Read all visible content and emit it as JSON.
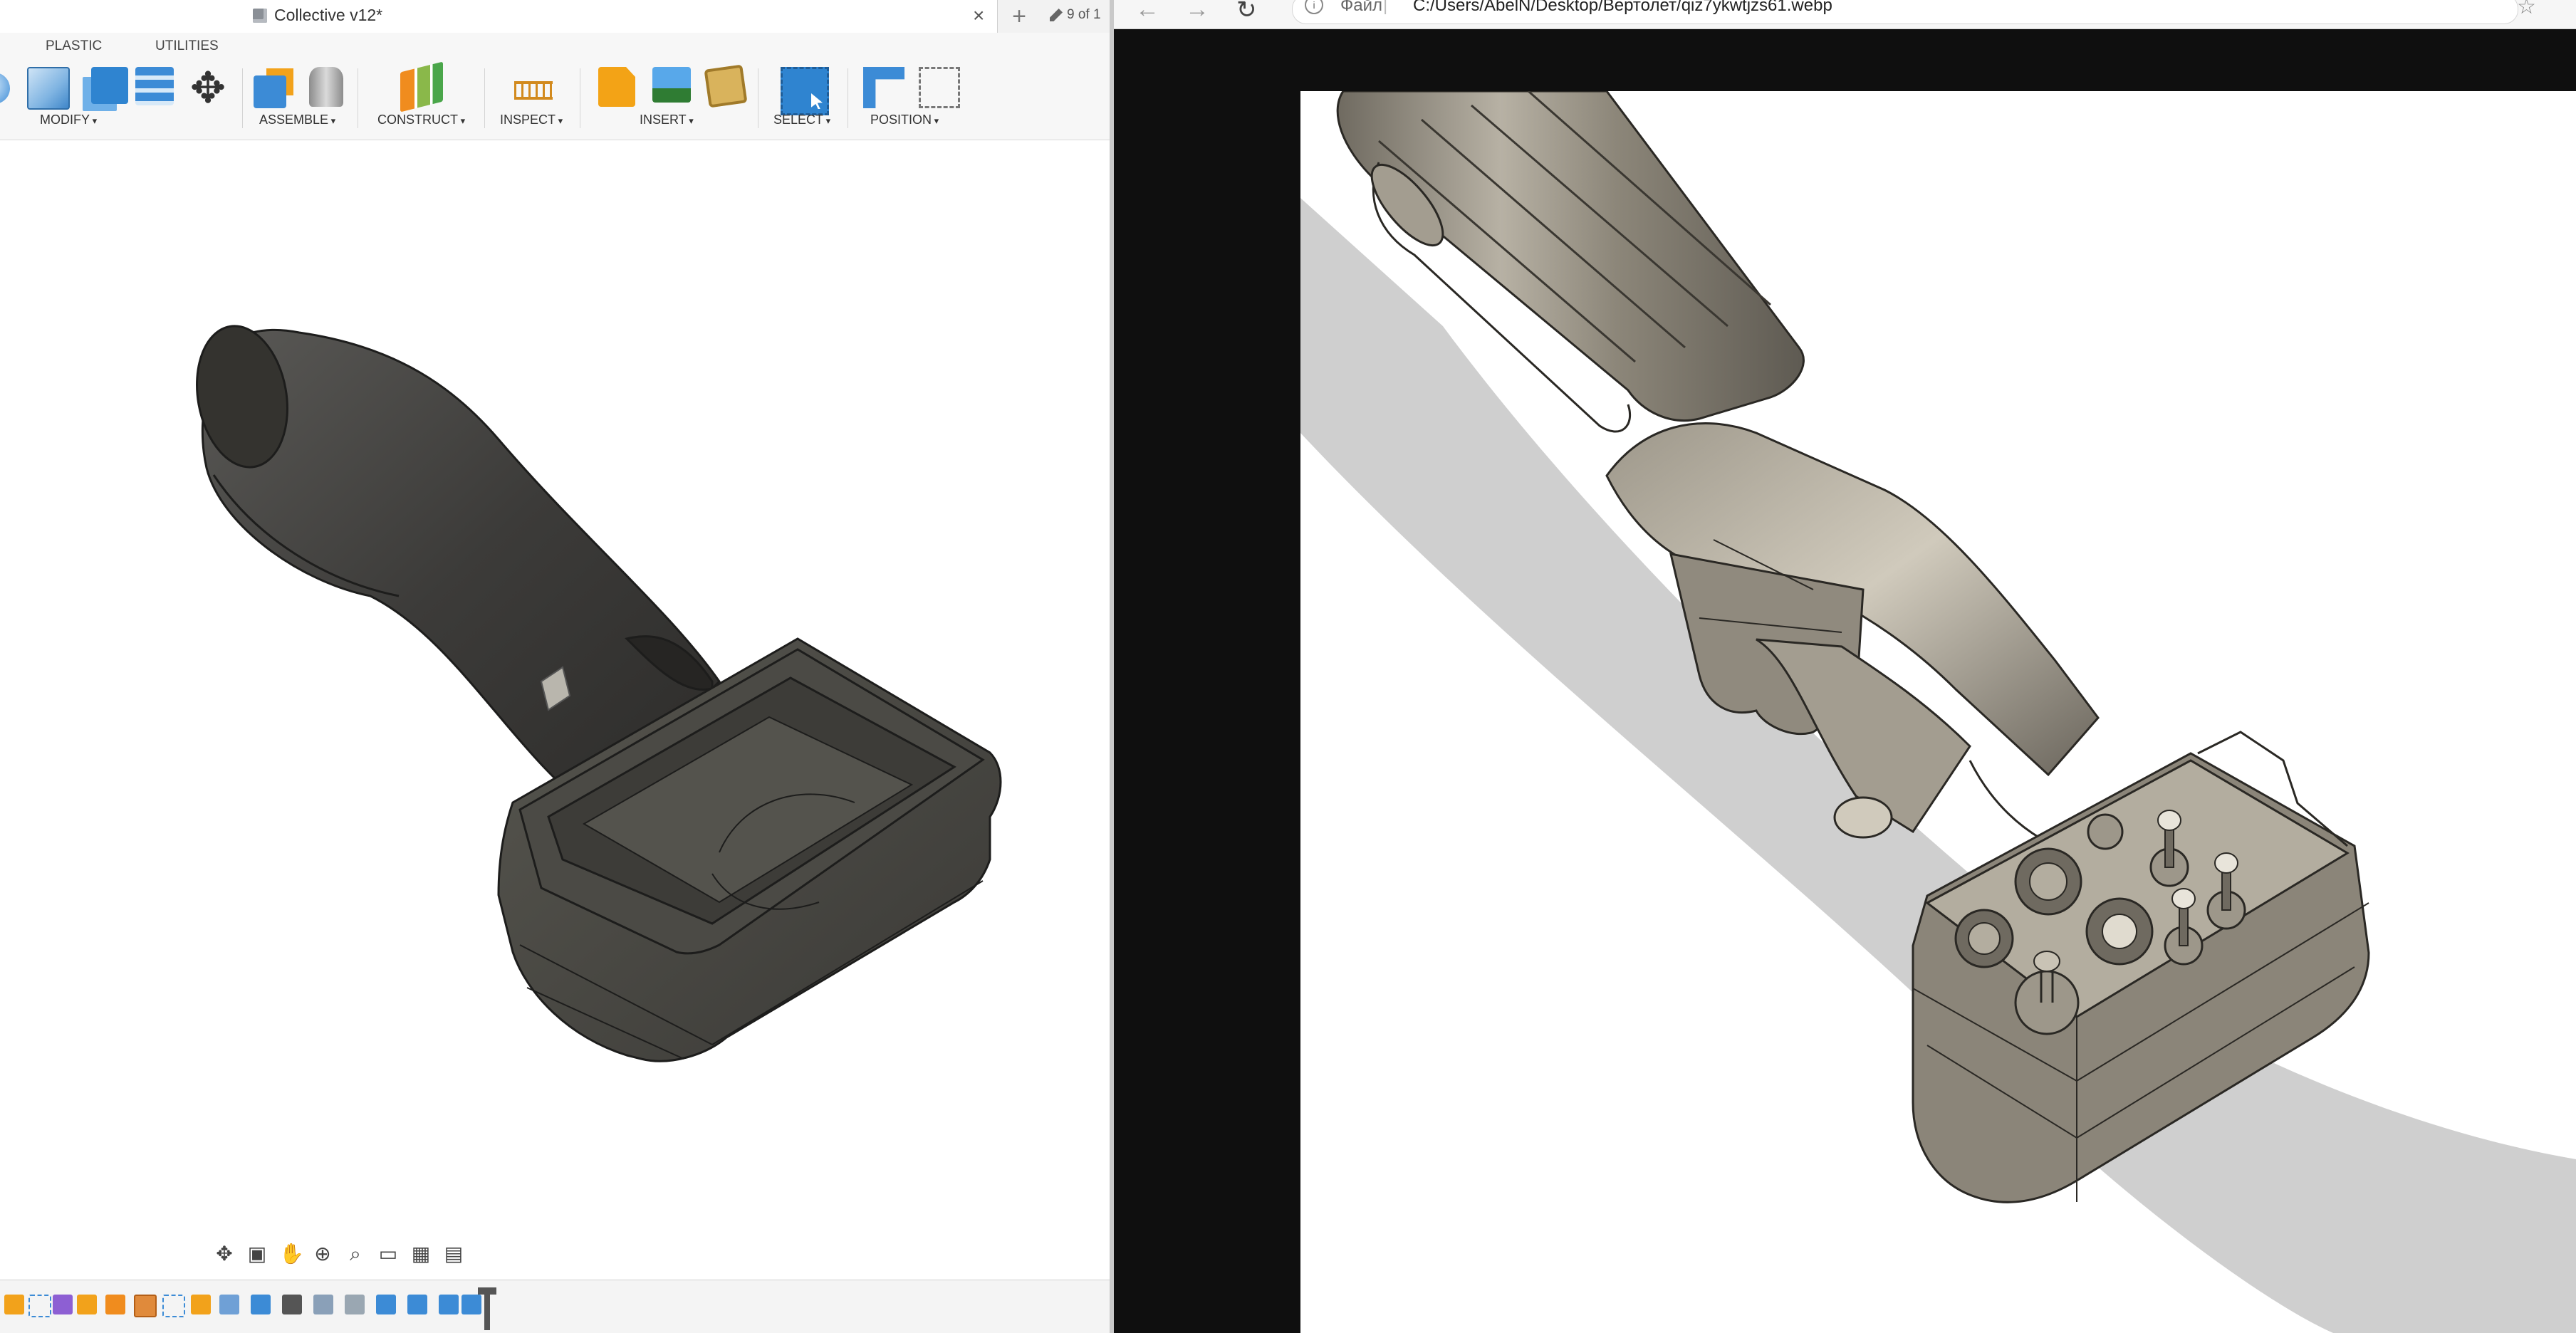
{
  "cad": {
    "document_title": "Collective v12*",
    "close_symbol": "×",
    "new_tab_symbol": "+",
    "doc_count": "9 of 1",
    "workspace_tabs": [
      "PLASTIC",
      "UTILITIES"
    ],
    "toolbar_groups": {
      "modify": "MODIFY",
      "assemble": "ASSEMBLE",
      "construct": "CONSTRUCT",
      "inspect": "INSPECT",
      "insert": "INSERT",
      "select": "SELECT",
      "position": "POSITION"
    },
    "icons": {
      "modify": [
        "press-pull-icon",
        "combine-icon",
        "split-body-icon",
        "move-icon"
      ],
      "assemble": [
        "new-component-icon",
        "joint-icon"
      ],
      "construct": [
        "offset-plane-icon"
      ],
      "inspect": [
        "measure-icon"
      ],
      "insert": [
        "insert-svg-icon",
        "canvas-image-icon",
        "insert-mesh-icon"
      ],
      "select": [
        "window-select-icon"
      ],
      "position": [
        "capture-position-icon",
        "revert-position-icon"
      ]
    },
    "nav_icons": [
      "orbit-icon",
      "look-at-icon",
      "pan-icon",
      "zoom-icon",
      "fit-icon",
      "display-settings-icon",
      "grid-settings-icon",
      "viewports-icon"
    ],
    "nav_glyphs": [
      "✥",
      "▣",
      "✋",
      "⊕",
      "⌕",
      "▭",
      "▦",
      "▤"
    ],
    "colors": {
      "model_body": "#4a4946",
      "model_edge": "#1e1e1e",
      "accent_blue": "#2f84d0",
      "accent_orange": "#f2a21b"
    }
  },
  "browser": {
    "back_symbol": "←",
    "forward_symbol": "→",
    "reload_symbol": "↻",
    "info_symbol": "i",
    "file_label": "Файл",
    "separator": "|",
    "url": "C:/Users/AbelN/Desktop/Вертолет/qiz7ykwtjzs61.webp",
    "star_symbol": "☆",
    "colors": {
      "backdrop": "#0f0f0f",
      "metal": "#8d877b",
      "shadow": "#cfcfcf"
    }
  }
}
